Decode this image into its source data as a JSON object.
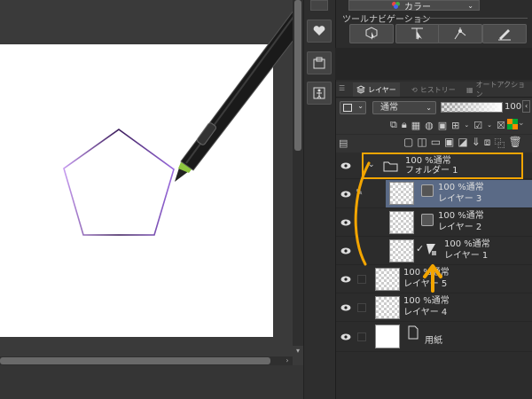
{
  "panel": {
    "color_dropdown": "カラー",
    "tool_nav_title": "ツールナビゲーション"
  },
  "tabs": [
    {
      "label": "レイヤー",
      "active": true
    },
    {
      "label": "ヒストリー",
      "active": false
    },
    {
      "label": "オートアクション",
      "active": false
    }
  ],
  "layer_props": {
    "blend_mode": "通常",
    "opacity": "100"
  },
  "layers": [
    {
      "percent_mode": "100 %通常",
      "name": "フォルダー 1",
      "type": "folder"
    },
    {
      "percent_mode": "100 %通常",
      "name": "レイヤー 3",
      "type": "raster"
    },
    {
      "percent_mode": "100 %通常",
      "name": "レイヤー 2",
      "type": "raster"
    },
    {
      "percent_mode": "100 %通常",
      "name": "レイヤー 1",
      "type": "vector"
    },
    {
      "percent_mode": "100 %通常",
      "name": "レイヤー 5",
      "type": "raster"
    },
    {
      "percent_mode": "100 %通常",
      "name": "レイヤー 4",
      "type": "raster"
    },
    {
      "percent_mode": "",
      "name": "用紙",
      "type": "paper"
    }
  ],
  "colors": {
    "highlight": "#f3a500",
    "selected_row": "#5a6a86",
    "pentagon_stroke": "#9b6be0"
  }
}
